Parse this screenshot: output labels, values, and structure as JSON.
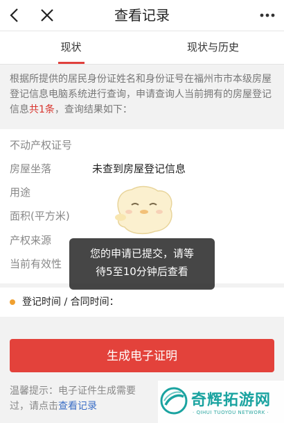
{
  "header": {
    "title": "查看记录",
    "back_icon": "chevron-left-icon",
    "close_icon": "close-icon",
    "more_icon": "more-dots-icon"
  },
  "tabs": [
    {
      "label": "现状",
      "active": true
    },
    {
      "label": "现状与历史",
      "active": false
    }
  ],
  "notice": {
    "text_before": "根据所提供的居民身份证姓名和身份证号在福州市市本级房屋登记信息电脑系统进行查询，申请查询人当前拥有的房屋登记信息",
    "highlight": "共1条",
    "text_after": "，查询结果如下："
  },
  "info": {
    "labels": [
      "不动产权证号",
      "房屋坐落",
      "用途",
      "面积(平方米)",
      "产权来源",
      "当前有效性"
    ],
    "result": "未查到房屋登记信息"
  },
  "record_time": {
    "label": "登记时间 / 合同时间："
  },
  "generate_button": {
    "label": "生成电子证明"
  },
  "tip": {
    "line1": "温馨提示：电子证件生成需要",
    "line2_prefix": "过，请点击",
    "link": "查看记录"
  },
  "toast": {
    "line1": "您的申请已提交，请等",
    "line2": "待5至10分钟后查看"
  },
  "watermark": {
    "title": "奇辉拓游网",
    "subtitle": "· QIHUI TUOYOU NETWORK ·"
  },
  "colors": {
    "accent": "#e3423b",
    "link": "#3b6ec6",
    "dot": "#f0a030",
    "watermark": "#1aa3a0"
  }
}
